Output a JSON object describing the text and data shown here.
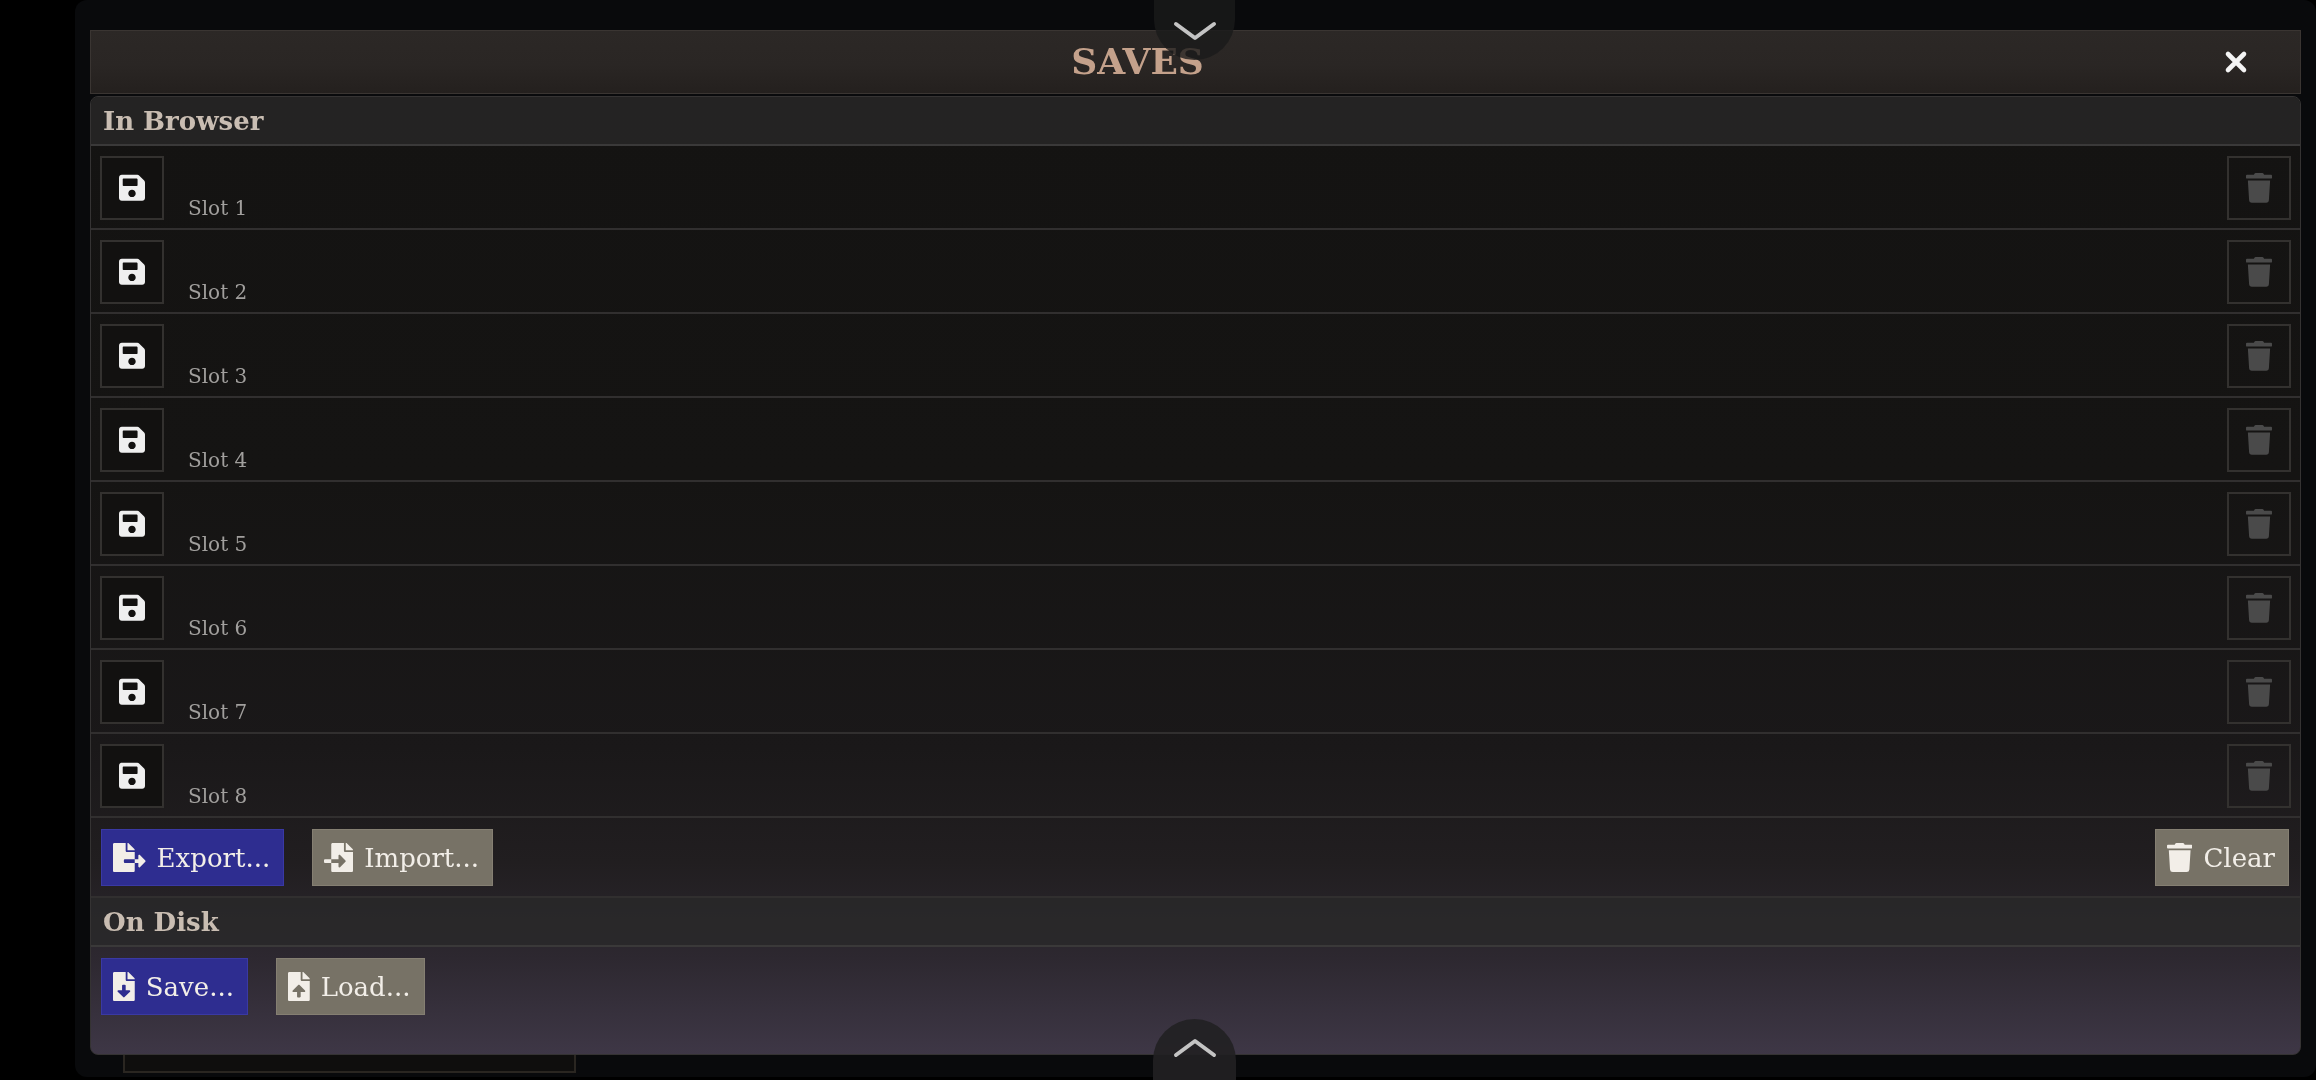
{
  "dialog": {
    "title": "SAVES"
  },
  "sections": [
    {
      "heading": "In Browser",
      "slots": [
        {
          "label": "Slot 1",
          "delete_disabled": true
        },
        {
          "label": "Slot 2",
          "delete_disabled": true
        },
        {
          "label": "Slot 3",
          "delete_disabled": true
        },
        {
          "label": "Slot 4",
          "delete_disabled": true
        },
        {
          "label": "Slot 5",
          "delete_disabled": true
        },
        {
          "label": "Slot 6",
          "delete_disabled": true
        },
        {
          "label": "Slot 7",
          "delete_disabled": true
        },
        {
          "label": "Slot 8",
          "delete_disabled": true
        }
      ],
      "actions": [
        {
          "kind": "export",
          "label": "Export...",
          "primary": true
        },
        {
          "kind": "import",
          "label": "Import...",
          "primary": false
        }
      ],
      "end_actions": [
        {
          "kind": "clear",
          "label": "Clear",
          "primary": false
        }
      ]
    },
    {
      "heading": "On Disk",
      "actions": [
        {
          "kind": "save",
          "label": "Save...",
          "primary": true
        },
        {
          "kind": "load",
          "label": "Load...",
          "primary": false
        }
      ]
    }
  ]
}
